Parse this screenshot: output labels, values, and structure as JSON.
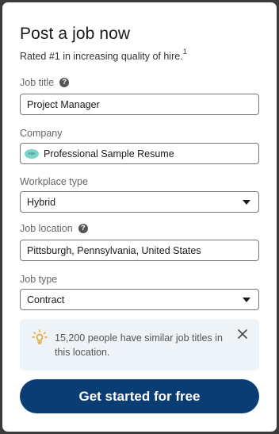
{
  "header": {
    "title": "Post a job now",
    "subtitle": "Rated #1 in increasing quality of hire.",
    "subtitle_footnote": "1"
  },
  "form": {
    "job_title": {
      "label": "Job title",
      "value": "Project Manager",
      "help_icon": "question-circle-icon"
    },
    "company": {
      "label": "Company",
      "value": "Professional Sample Resume",
      "logo_text": "PSR"
    },
    "workplace_type": {
      "label": "Workplace type",
      "value": "Hybrid"
    },
    "job_location": {
      "label": "Job location",
      "value": "Pittsburgh, Pennsylvania, United States",
      "help_icon": "question-circle-icon"
    },
    "job_type": {
      "label": "Job type",
      "value": "Contract"
    }
  },
  "insight": {
    "icon": "lightbulb-icon",
    "text": "15,200 people have similar job titles in this location.",
    "icon_color": "#e5a127"
  },
  "cta": {
    "label": "Get started for free",
    "color": "#0a3d73"
  }
}
